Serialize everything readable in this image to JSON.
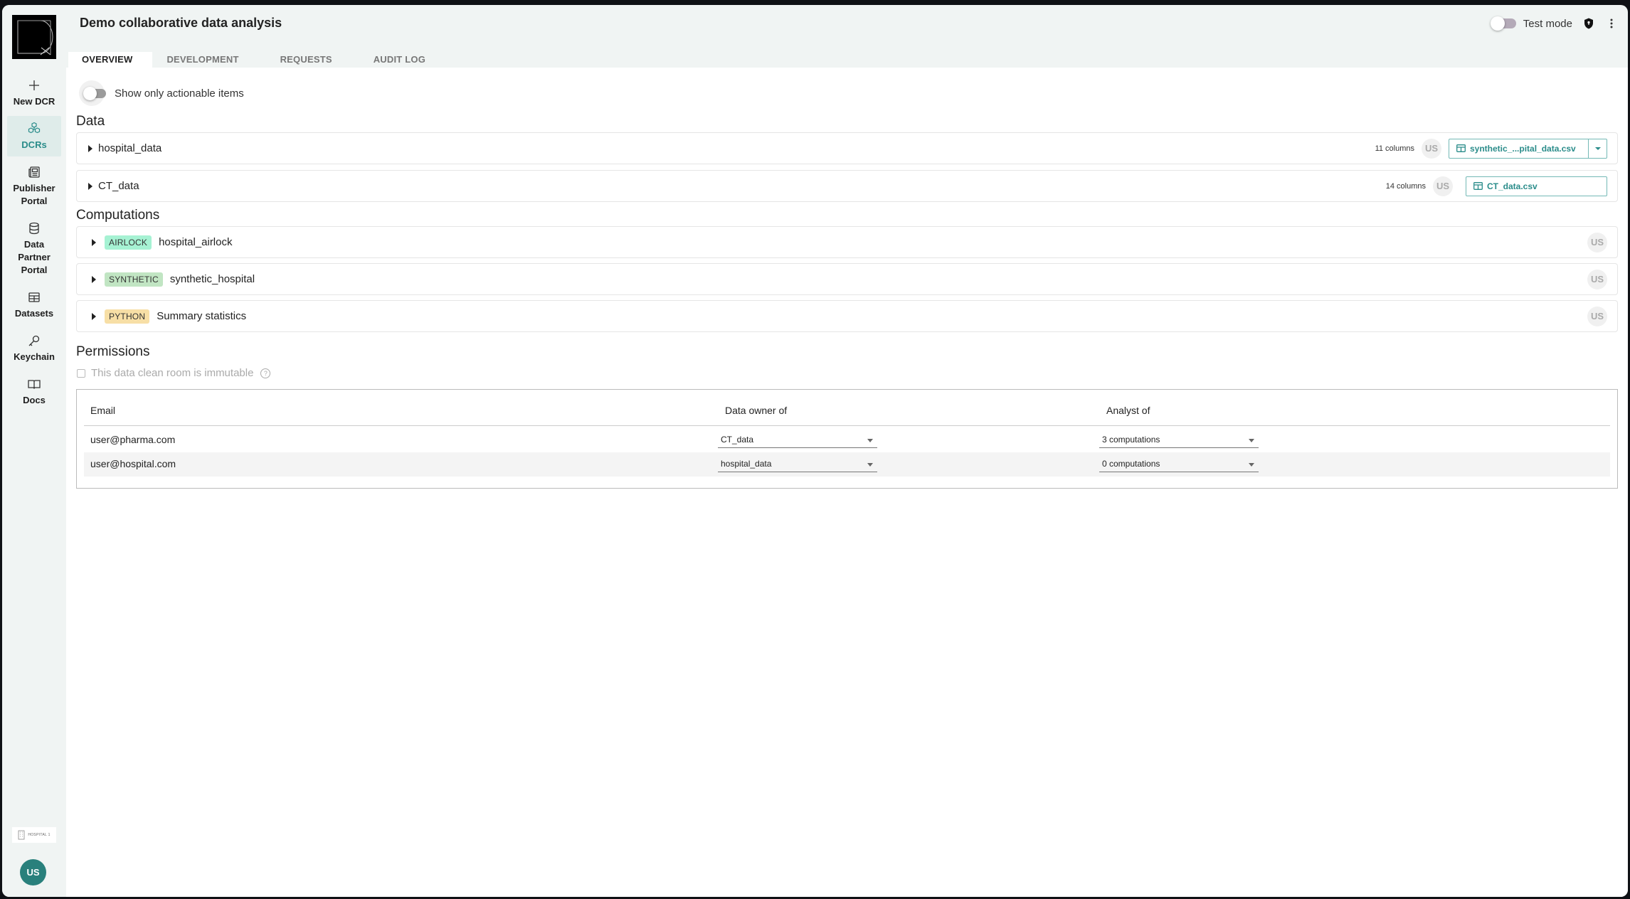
{
  "app": {
    "title": "Demo collaborative data analysis",
    "test_mode_label": "Test mode",
    "test_mode_on": false
  },
  "sidebar": {
    "items": [
      {
        "label": "New DCR",
        "icon": "plus-icon"
      },
      {
        "label": "DCRs",
        "icon": "cubes-icon",
        "active": true
      },
      {
        "label": "Publisher Portal",
        "icon": "newspaper-icon"
      },
      {
        "label": "Data Partner Portal",
        "icon": "database-icon"
      },
      {
        "label": "Datasets",
        "icon": "table-icon"
      },
      {
        "label": "Keychain",
        "icon": "key-icon"
      },
      {
        "label": "Docs",
        "icon": "book-icon"
      }
    ],
    "org_label": "HOSPITAL 1",
    "user_initials": "US"
  },
  "tabs": [
    {
      "label": "OVERVIEW",
      "active": true
    },
    {
      "label": "DEVELOPMENT"
    },
    {
      "label": "REQUESTS"
    },
    {
      "label": "AUDIT LOG"
    }
  ],
  "overview": {
    "actionable_label": "Show only actionable items",
    "actionable_on": false,
    "data_title": "Data",
    "data": [
      {
        "name": "hospital_data",
        "columns": "11 columns",
        "owner": "US",
        "file": "synthetic_...pital_data.csv",
        "has_dropdown": true
      },
      {
        "name": "CT_data",
        "columns": "14 columns",
        "owner": "US",
        "file": "CT_data.csv",
        "has_dropdown": false
      }
    ],
    "computations_title": "Computations",
    "computations": [
      {
        "type": "AIRLOCK",
        "name": "hospital_airlock",
        "owner": "US",
        "color": "#a6f2d3"
      },
      {
        "type": "SYNTHETIC",
        "name": "synthetic_hospital",
        "owner": "US",
        "color": "#c1e5c3"
      },
      {
        "type": "PYTHON",
        "name": "Summary statistics",
        "owner": "US",
        "color": "#f7dfa6"
      }
    ],
    "permissions_title": "Permissions",
    "immutable_label": "This data clean room is immutable",
    "immutable_checked": false,
    "help_glyph": "?",
    "table": {
      "headers": [
        "Email",
        "Data owner of",
        "Analyst of"
      ],
      "rows": [
        {
          "email": "user@pharma.com",
          "owner_of": "CT_data",
          "analyst_of": "3 computations"
        },
        {
          "email": "user@hospital.com",
          "owner_of": "hospital_data",
          "analyst_of": "0 computations"
        }
      ]
    }
  },
  "colors": {
    "accent": "#2a8c8a",
    "avatar": "#29807c",
    "sidebar_bg": "#f0f4f3"
  }
}
